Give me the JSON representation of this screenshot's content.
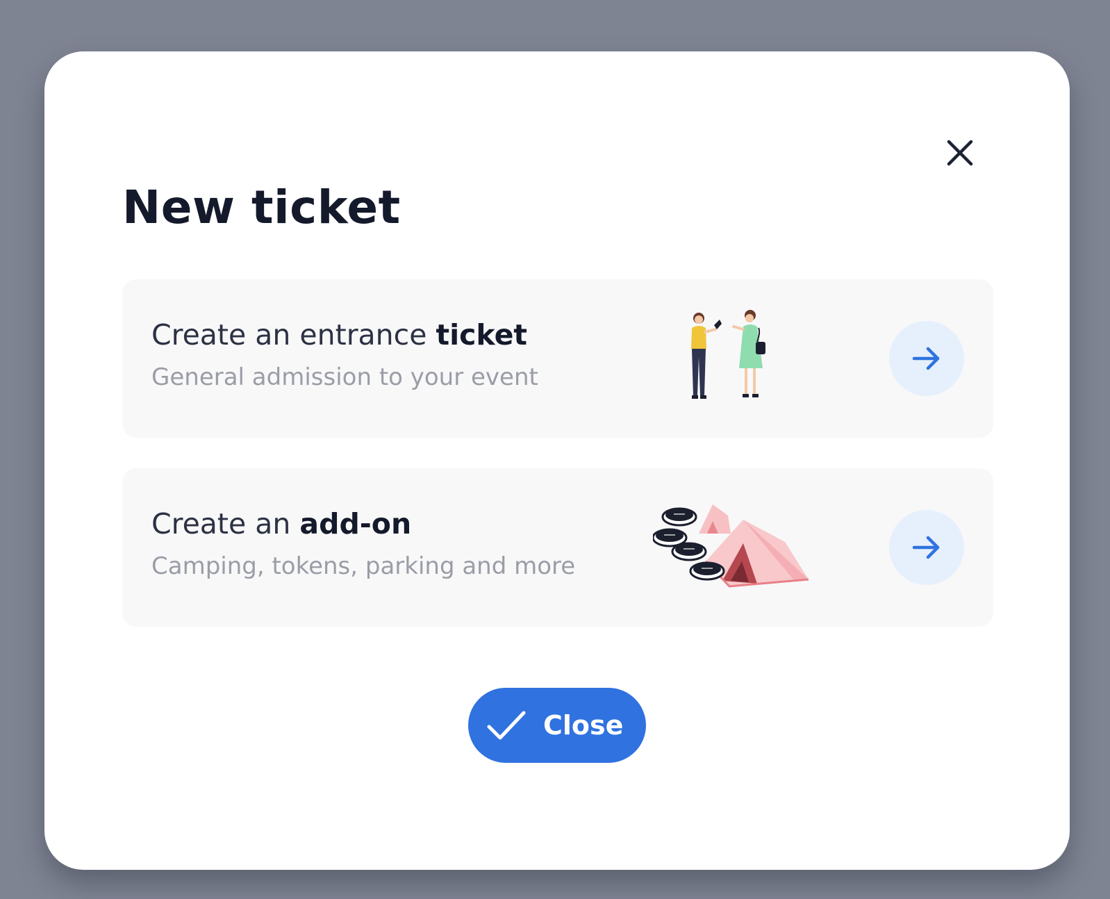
{
  "dialog": {
    "title": "New ticket",
    "close_icon": "close-icon"
  },
  "options": [
    {
      "heading_prefix": "Create an entrance ",
      "heading_bold": "ticket",
      "subtitle": "General admission to your event",
      "illustration": "two-people-illustration",
      "action_icon": "arrow-right-icon"
    },
    {
      "heading_prefix": "Create an ",
      "heading_bold": "add-on",
      "subtitle": "Camping, tokens, parking and more",
      "illustration": "tent-tokens-illustration",
      "action_icon": "arrow-right-icon"
    }
  ],
  "footer": {
    "close_label": "Close",
    "close_icon": "check-icon"
  },
  "colors": {
    "backdrop": "#7f8493",
    "accent": "#2f72e0",
    "arrow_bg": "#e6f0fc",
    "card_bg": "#f8f8f9"
  }
}
